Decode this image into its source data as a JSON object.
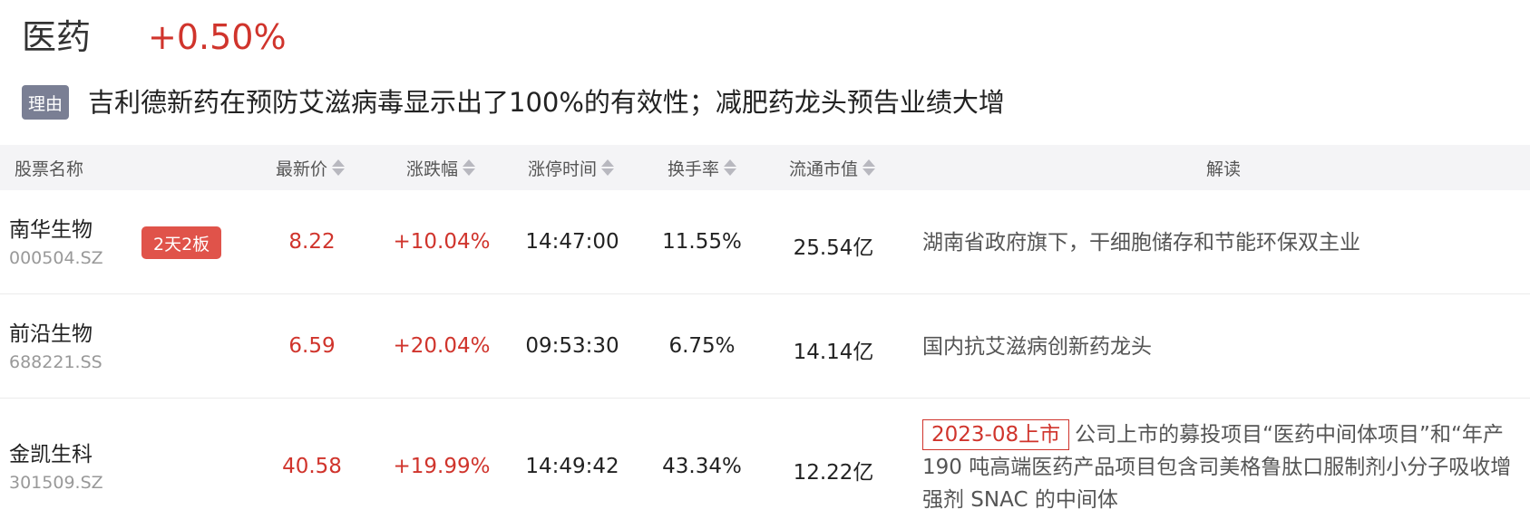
{
  "header": {
    "sector": "医药",
    "change": "+0.50%"
  },
  "reason": {
    "tag": "理由",
    "text": "吉利德新药在预防艾滋病毒显示出了100%的有效性；减肥药龙头预告业绩大增"
  },
  "columns": {
    "name": "股票名称",
    "price": "最新价",
    "change": "涨跌幅",
    "limit_time": "涨停时间",
    "turnover": "换手率",
    "market_cap": "流通市值",
    "note": "解读"
  },
  "rows": [
    {
      "name": "南华生物",
      "code": "000504.SZ",
      "badge": "2天2板",
      "price": "8.22",
      "change": "+10.04%",
      "limit_time": "14:47:00",
      "turnover": "11.55%",
      "market_cap": "25.54亿",
      "note": "湖南省政府旗下，干细胞储存和节能环保双主业"
    },
    {
      "name": "前沿生物",
      "code": "688221.SS",
      "price": "6.59",
      "change": "+20.04%",
      "limit_time": "09:53:30",
      "turnover": "6.75%",
      "market_cap": "14.14亿",
      "note": "国内抗艾滋病创新药龙头"
    },
    {
      "name": "金凯生科",
      "code": "301509.SZ",
      "price": "40.58",
      "change": "+19.99%",
      "limit_time": "14:49:42",
      "turnover": "43.34%",
      "market_cap": "12.22亿",
      "list_tag": "2023-08上市",
      "note": "公司上市的募投项目“医药中间体项目”和“年产190 吨高端医药产品项目包含司美格鲁肽口服制剂小分子吸收增强剂 SNAC 的中间体"
    }
  ],
  "colors": {
    "up": "#d0342c",
    "badge": "#e0534a",
    "reason_tag": "#7a7f94",
    "header_bg": "#f4f4f6"
  }
}
